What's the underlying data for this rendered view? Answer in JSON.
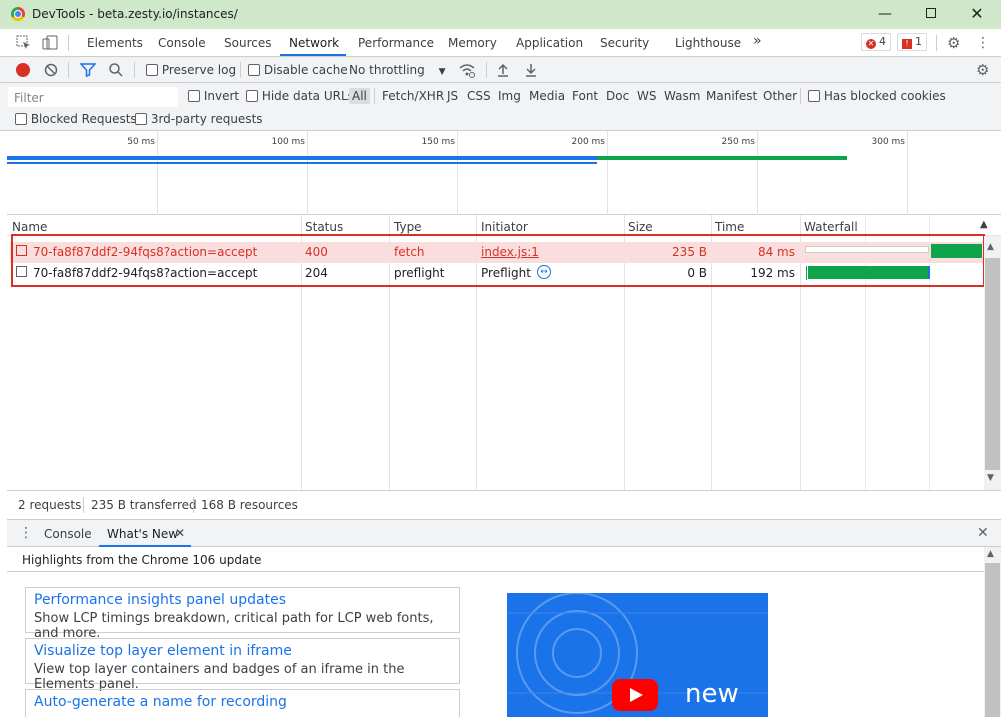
{
  "window": {
    "title": "DevTools - beta.zesty.io/instances/"
  },
  "tabs": [
    "Elements",
    "Console",
    "Sources",
    "Network",
    "Performance",
    "Memory",
    "Application",
    "Security",
    "Lighthouse"
  ],
  "more_tabs": "»",
  "badges": {
    "errors": "4",
    "issues": "1"
  },
  "toolbar": {
    "preserve_log": "Preserve log",
    "disable_cache": "Disable cache",
    "throttling": "No throttling"
  },
  "filter": {
    "placeholder": "Filter",
    "invert": "Invert",
    "hide_data_urls": "Hide data URLs",
    "types": [
      "All",
      "Fetch/XHR",
      "JS",
      "CSS",
      "Img",
      "Media",
      "Font",
      "Doc",
      "WS",
      "Wasm",
      "Manifest",
      "Other"
    ],
    "has_blocked_cookies": "Has blocked cookies",
    "blocked_requests": "Blocked Requests",
    "third_party": "3rd-party requests"
  },
  "overview": {
    "ticks": [
      "50 ms",
      "100 ms",
      "150 ms",
      "200 ms",
      "250 ms",
      "300 ms"
    ]
  },
  "table": {
    "columns": [
      "Name",
      "Status",
      "Type",
      "Initiator",
      "Size",
      "Time",
      "Waterfall"
    ],
    "rows": [
      {
        "name": "70-fa8f87ddf2-94fqs8?action=accept",
        "status": "400",
        "type": "fetch",
        "initiator": "index.js:1",
        "size": "235 B",
        "time": "84 ms",
        "error": true
      },
      {
        "name": "70-fa8f87ddf2-94fqs8?action=accept",
        "status": "204",
        "type": "preflight",
        "initiator": "Preflight",
        "size": "0 B",
        "time": "192 ms",
        "error": false
      }
    ]
  },
  "status": {
    "requests": "2 requests",
    "transferred": "235 B transferred",
    "resources": "168 B resources"
  },
  "drawer": {
    "tabs": [
      "Console",
      "What's New"
    ],
    "headline": "Highlights from the Chrome 106 update",
    "cards": [
      {
        "title": "Performance insights panel updates",
        "desc": "Show LCP timings breakdown, critical path for LCP web fonts, and more."
      },
      {
        "title": "Visualize top layer element in iframe",
        "desc": "View top layer containers and badges of an iframe in the Elements panel."
      },
      {
        "title": "Auto-generate a name for recording",
        "desc": ""
      }
    ],
    "promo_text": "new"
  },
  "colors": {
    "accent": "#1a73e8",
    "error": "#d93025",
    "success": "#0ea44b",
    "titlebar": "#cfe8c9"
  }
}
